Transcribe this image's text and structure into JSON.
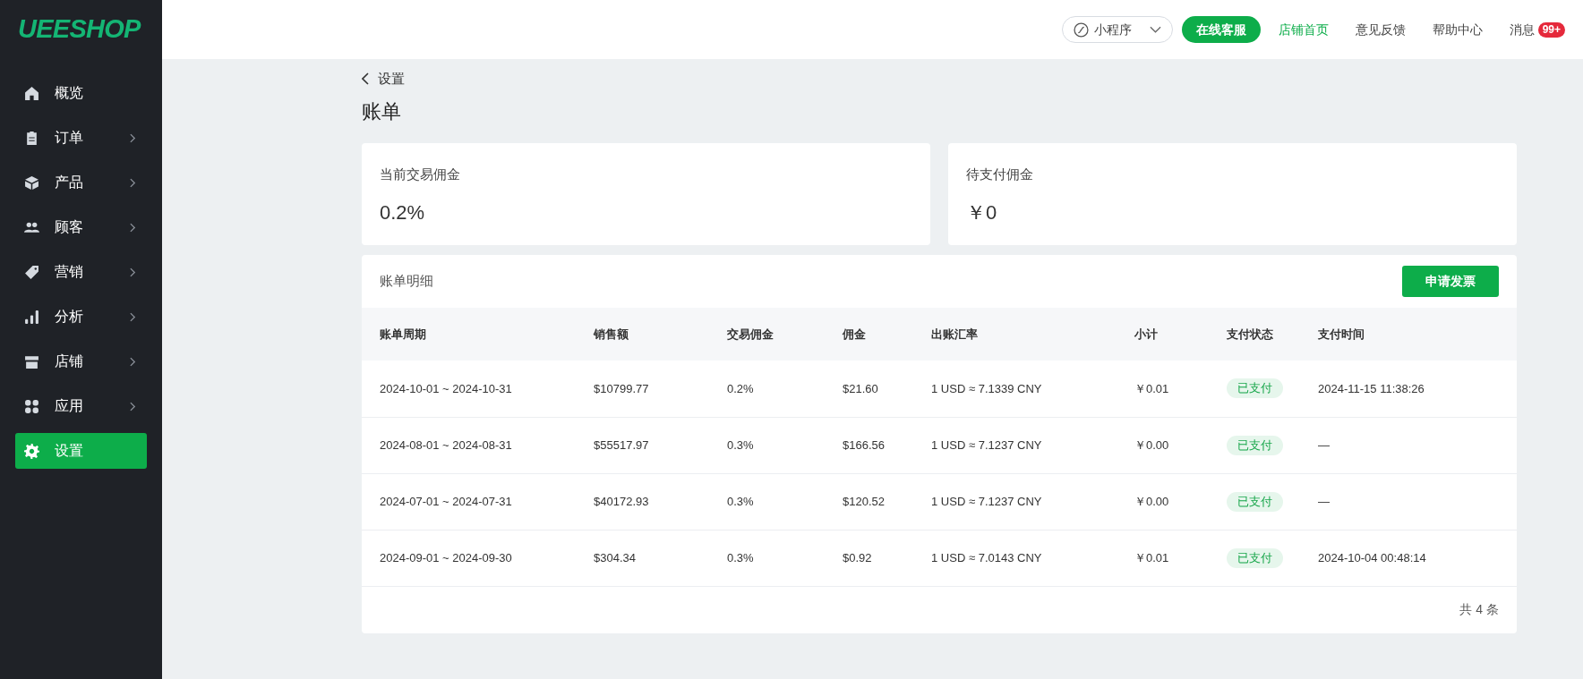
{
  "logo": "UEESHOP",
  "sidebar": {
    "items": [
      {
        "label": "概览",
        "expandable": false,
        "selected": false
      },
      {
        "label": "订单",
        "expandable": true,
        "selected": false
      },
      {
        "label": "产品",
        "expandable": true,
        "selected": false
      },
      {
        "label": "顾客",
        "expandable": true,
        "selected": false
      },
      {
        "label": "营销",
        "expandable": true,
        "selected": false
      },
      {
        "label": "分析",
        "expandable": true,
        "selected": false
      },
      {
        "label": "店铺",
        "expandable": true,
        "selected": false
      },
      {
        "label": "应用",
        "expandable": true,
        "selected": false
      },
      {
        "label": "设置",
        "expandable": false,
        "selected": true
      }
    ]
  },
  "topbar": {
    "mini_program": "小程序",
    "service_button": "在线客服",
    "links": [
      {
        "label": "店铺首页",
        "active": true
      },
      {
        "label": "意见反馈",
        "active": false
      },
      {
        "label": "帮助中心",
        "active": false
      }
    ],
    "messages": {
      "label": "消息",
      "badge": "99+"
    }
  },
  "back_link": "设置",
  "page_title": "账单",
  "stats": [
    {
      "label": "当前交易佣金",
      "value": "0.2%"
    },
    {
      "label": "待支付佣金",
      "value": "￥0"
    }
  ],
  "table": {
    "title": "账单明细",
    "action_button": "申请发票",
    "columns": [
      "账单周期",
      "销售额",
      "交易佣金",
      "佣金",
      "出账汇率",
      "小计",
      "支付状态",
      "支付时间"
    ],
    "rows": [
      {
        "cells": [
          "2024-10-01 ~ 2024-10-31",
          "$10799.77",
          "0.2%",
          "$21.60",
          "1 USD ≈ 7.1339 CNY",
          "￥0.01"
        ],
        "status": {
          "text": "已支付",
          "kind": "paid"
        },
        "paid_time": "2024-11-15 11:38:26"
      },
      {
        "cells": [
          "2024-08-01 ~ 2024-08-31",
          "$55517.97",
          "0.3%",
          "$166.56",
          "1 USD ≈ 7.1237 CNY",
          "￥0.00"
        ],
        "status": {
          "text": "已支付",
          "kind": "paid"
        },
        "paid_time": "—"
      },
      {
        "cells": [
          "2024-07-01 ~ 2024-07-31",
          "$40172.93",
          "0.3%",
          "$120.52",
          "1 USD ≈ 7.1237 CNY",
          "￥0.00"
        ],
        "status": {
          "text": "已支付",
          "kind": "paid"
        },
        "paid_time": "—"
      },
      {
        "cells": [
          "2024-09-01 ~ 2024-09-30",
          "$304.34",
          "0.3%",
          "$0.92",
          "1 USD ≈ 7.0143 CNY",
          "￥0.01"
        ],
        "status": {
          "text": "已支付",
          "kind": "paid"
        },
        "paid_time": "2024-10-04 00:48:14"
      }
    ],
    "total": "共 4 条"
  }
}
